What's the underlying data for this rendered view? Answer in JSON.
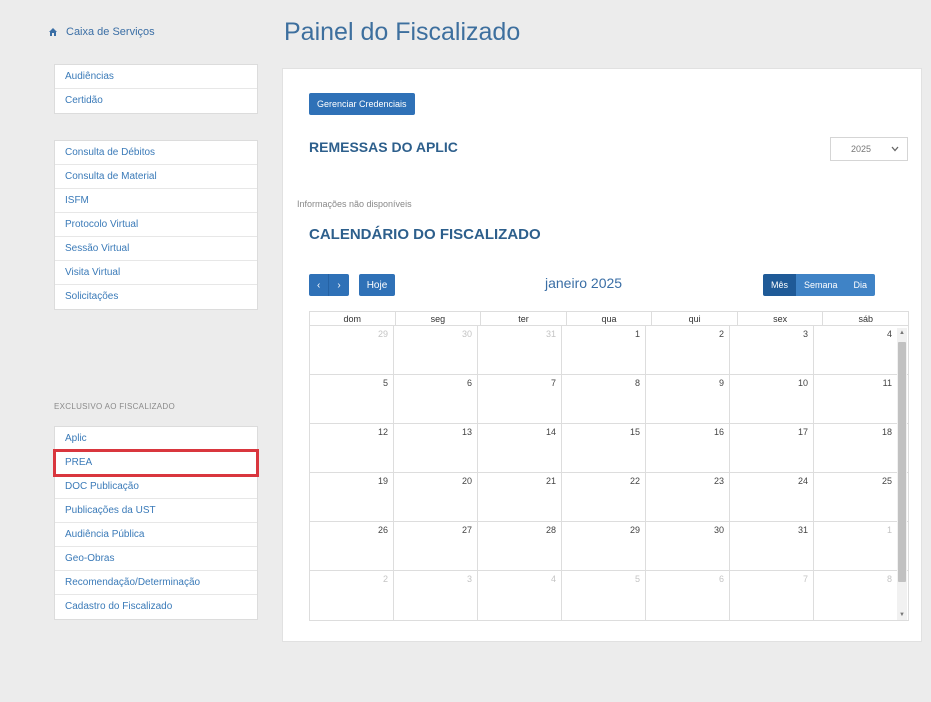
{
  "sidebar": {
    "header_label": "Caixa de Serviços",
    "group1": [
      "Audiências",
      "Certidão"
    ],
    "group2": [
      "Consulta de Débitos",
      "Consulta de Material",
      "ISFM",
      "Protocolo Virtual",
      "Sessão Virtual",
      "Visita Virtual",
      "Solicitações"
    ],
    "section_label": "EXCLUSIVO AO FISCALIZADO",
    "group3": [
      "Aplic",
      "PREA",
      "DOC Publicação",
      "Publicações da UST",
      "Audiência Pública",
      "Geo-Obras",
      "Recomendação/Determinação",
      "Cadastro do Fiscalizado"
    ]
  },
  "page": {
    "title": "Painel do Fiscalizado"
  },
  "panel": {
    "credentials_button": "Gerenciar Credenciais",
    "remessas_heading": "REMESSAS DO APLIC",
    "year_value": "2025",
    "info_text": "Informações não disponíveis",
    "calendar_heading": "CALENDÁRIO DO FISCALIZADO"
  },
  "calendar": {
    "prev_label": "‹",
    "next_label": "›",
    "today_label": "Hoje",
    "month_title": "janeiro 2025",
    "views": [
      "Mês",
      "Semana",
      "Dia"
    ],
    "active_view": "Mês",
    "weekdays": [
      "dom",
      "seg",
      "ter",
      "qua",
      "qui",
      "sex",
      "sáb"
    ],
    "weeks": [
      [
        {
          "d": "29",
          "o": true
        },
        {
          "d": "30",
          "o": true
        },
        {
          "d": "31",
          "o": true
        },
        {
          "d": "1"
        },
        {
          "d": "2"
        },
        {
          "d": "3"
        },
        {
          "d": "4"
        }
      ],
      [
        {
          "d": "5"
        },
        {
          "d": "6"
        },
        {
          "d": "7"
        },
        {
          "d": "8"
        },
        {
          "d": "9"
        },
        {
          "d": "10"
        },
        {
          "d": "11"
        }
      ],
      [
        {
          "d": "12"
        },
        {
          "d": "13"
        },
        {
          "d": "14"
        },
        {
          "d": "15"
        },
        {
          "d": "16"
        },
        {
          "d": "17"
        },
        {
          "d": "18"
        }
      ],
      [
        {
          "d": "19"
        },
        {
          "d": "20"
        },
        {
          "d": "21"
        },
        {
          "d": "22"
        },
        {
          "d": "23"
        },
        {
          "d": "24"
        },
        {
          "d": "25"
        }
      ],
      [
        {
          "d": "26"
        },
        {
          "d": "27"
        },
        {
          "d": "28"
        },
        {
          "d": "29"
        },
        {
          "d": "30"
        },
        {
          "d": "31"
        },
        {
          "d": "1",
          "o": true
        }
      ],
      [
        {
          "d": "2",
          "o": true
        },
        {
          "d": "3",
          "o": true
        },
        {
          "d": "4",
          "o": true
        },
        {
          "d": "5",
          "o": true
        },
        {
          "d": "6",
          "o": true
        },
        {
          "d": "7",
          "o": true
        },
        {
          "d": "8",
          "o": true
        }
      ]
    ]
  },
  "colors": {
    "primary": "#2f71b7",
    "highlight": "#d9363e",
    "title": "#3d6f9e"
  },
  "icons": {
    "home": "home-icon",
    "select_arrow": "chevron-down-icon"
  }
}
